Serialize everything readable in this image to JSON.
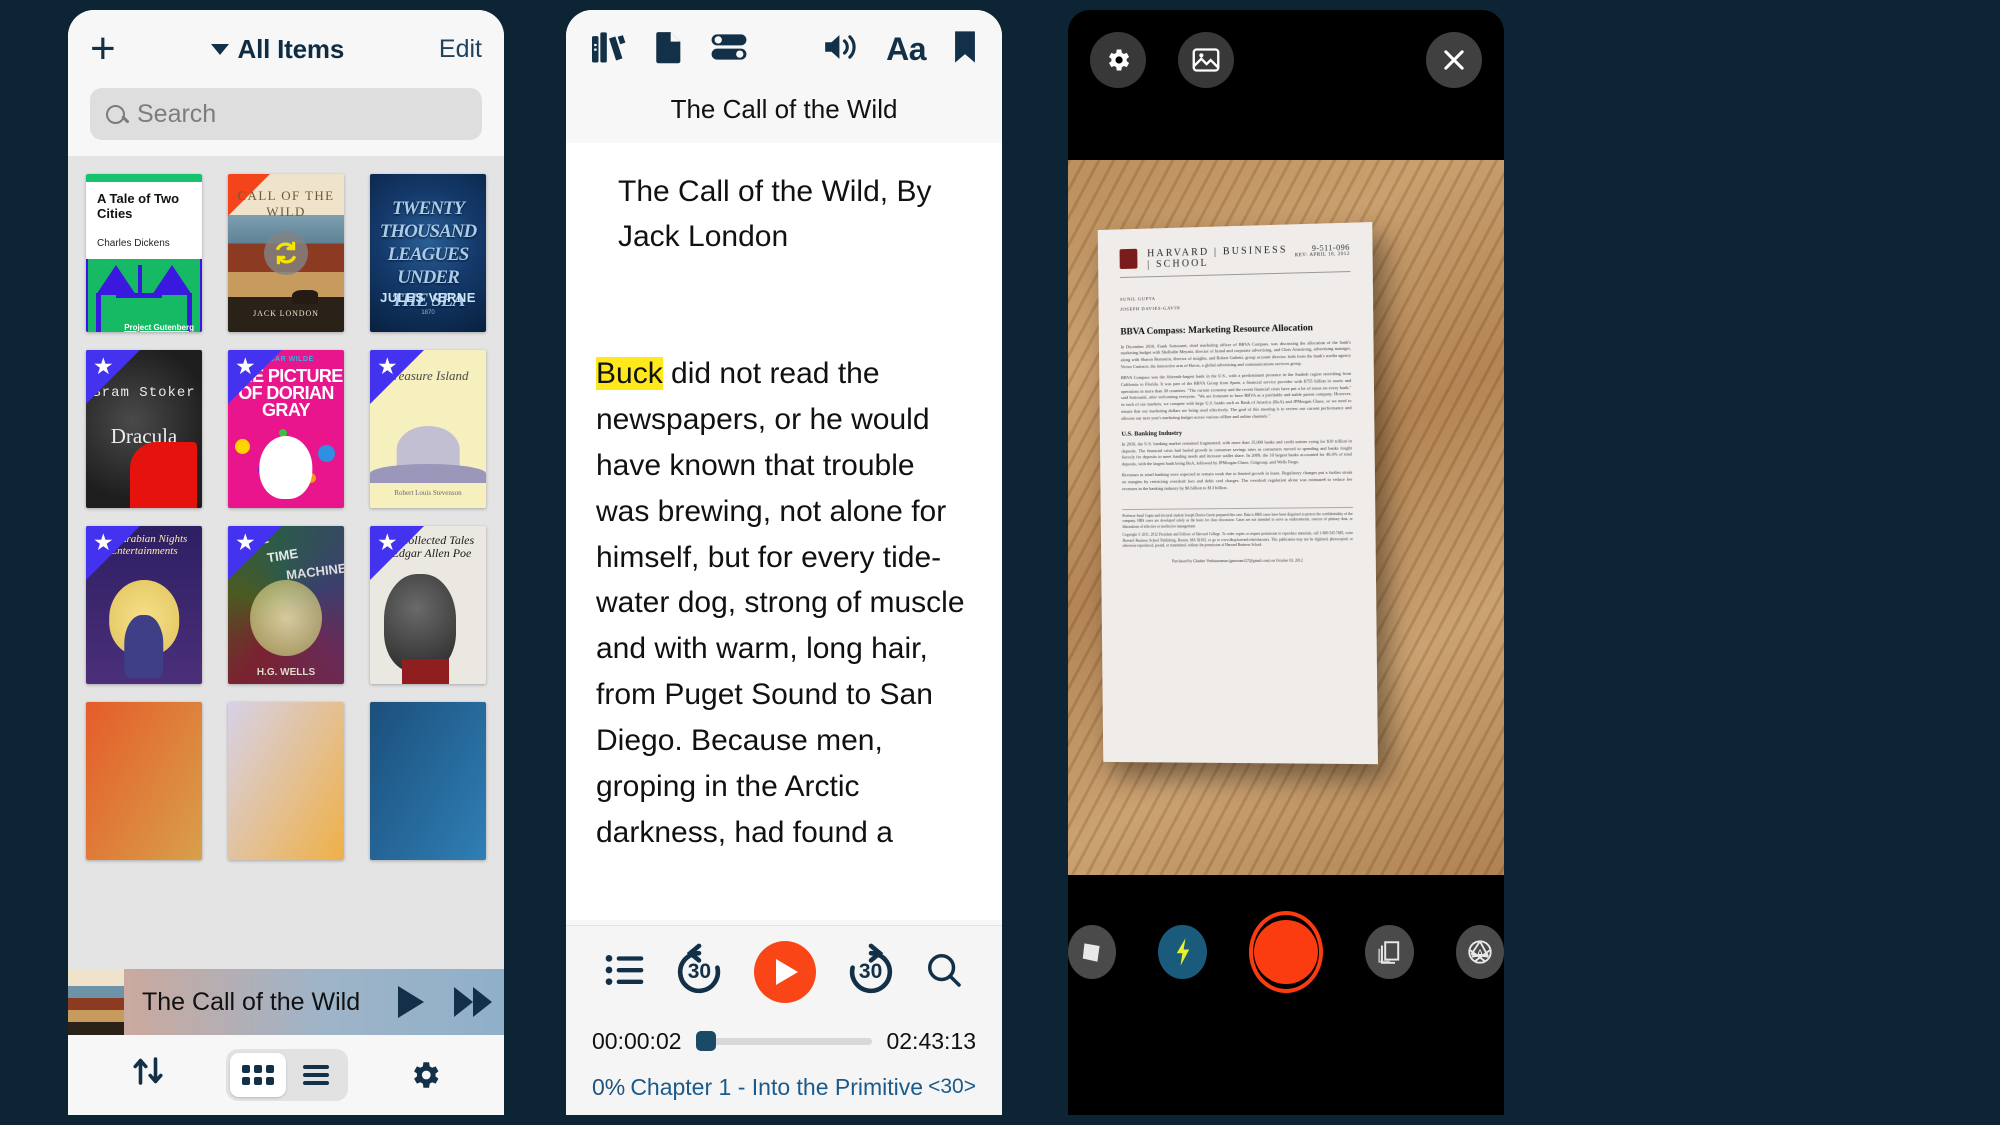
{
  "library": {
    "add_label": "+",
    "title": "All Items",
    "edit_label": "Edit",
    "search_placeholder": "Search",
    "books": [
      {
        "title": "A Tale of Two Cities",
        "author": "Charles Dickens",
        "publisher": "Project Gutenberg",
        "starred": false,
        "syncing": false
      },
      {
        "title": "CALL OF THE WILD",
        "author": "JACK LONDON",
        "starred": false,
        "syncing": true
      },
      {
        "title": "TWENTY THOUSAND LEAGUES UNDER THE SEA",
        "author": "JULES VERNE",
        "starred": false,
        "syncing": false
      },
      {
        "title": "Dracula",
        "author": "Bram Stoker",
        "starred": true,
        "syncing": false
      },
      {
        "title": "THE PICTURE OF DORIAN GRAY",
        "author": "OSCAR WILDE",
        "starred": true,
        "syncing": false
      },
      {
        "title": "Treasure Island",
        "author": "Robert Louis Stevenson",
        "starred": true,
        "syncing": false
      },
      {
        "title": "The Arabian Nights Entertainments",
        "author": "",
        "starred": true,
        "syncing": false
      },
      {
        "title": "THE TIME MACHINE",
        "author": "H.G. WELLS",
        "starred": true,
        "syncing": false
      },
      {
        "title": "The Collected Tales of Edgar Allen Poe",
        "author": "",
        "starred": true,
        "syncing": false
      }
    ],
    "mini_player": {
      "title": "The Call of the Wild",
      "play_icon": "play-icon",
      "forward_icon": "fast-forward-icon"
    },
    "tabbar": {
      "sort_icon": "sort-arrows-icon",
      "grid_icon": "grid-view-icon",
      "list_icon": "list-view-icon",
      "settings_icon": "gear-icon",
      "active_view": "grid"
    }
  },
  "reader": {
    "toolbar_left": [
      {
        "icon": "bookshelf-icon",
        "label": "Library"
      },
      {
        "icon": "document-icon",
        "label": "Document"
      },
      {
        "icon": "sliders-icon",
        "label": "Settings"
      }
    ],
    "toolbar_right": [
      {
        "icon": "speaker-icon",
        "label": "Audio"
      },
      {
        "icon": "text-size-icon",
        "label": "Aa"
      },
      {
        "icon": "bookmark-icon",
        "label": "Bookmark"
      }
    ],
    "title": "The Call of the Wild",
    "heading": "The Call of the Wild, By Jack London",
    "highlight_word": "Buck",
    "paragraph": " did not read the newspapers, or he would have known that trouble was brewing, not alone for himself, but for every tide- water dog, strong of muscle and with warm, long hair, from Puget Sound to San Diego. Because men, groping in the Arctic darkness, had found a",
    "controls": {
      "toc_icon": "list-icon",
      "rewind_label": "30",
      "play_icon": "play-icon",
      "forward_label": "30",
      "search_icon": "search-icon"
    },
    "elapsed": "00:00:02",
    "duration": "02:43:13",
    "progress_percent": "0%",
    "chapter": "Chapter 1 - Into the Primitive",
    "chapter_nav": "30",
    "progress_value": 0
  },
  "scanner": {
    "settings_icon": "gear-icon",
    "gallery_icon": "image-icon",
    "close_icon": "close-icon",
    "document": {
      "institution": "HARVARD | BUSINESS | SCHOOL",
      "code": "9-511-096",
      "revision": "REV: APRIL 18, 2012",
      "author_1": "SUNIL GUPTA",
      "author_2": "JOSEPH DAVIES-GAVIN",
      "title": "BBVA Compass: Marketing Resource Allocation",
      "para_1": "In December 2010, Frank Sottosanti, chief marketing officer of BBVA Compass, was discussing the allocation of the bank's marketing budget with Shelludin Meyatti, director of brand and corporate advertising, and Chris Armstrong, advertising manager, along with Sharon Bernstein, director of insights, and Robert Galietti, group account director, both from the bank's media agency Vector Contacts, the interactive arm of Havas, a global advertising and communications services group.",
      "para_2": "BBVA Compass was the fifteenth-largest bank in the U.S., with a predominant presence in the Sunbelt region stretching from California to Florida. It was part of the BBVA Group from Spain, a financial service provider with $755 billion in assets and operations in more than 30 countries. \"The current economy and the recent financial crisis have put a lot of stress on every bank,\" said Sottosanti, after welcoming everyone. \"We are fortunate to have BBVA as a profitable and stable parent company. However, in each of our markets, we compete with large U.S. banks such as Bank of America (BoA) and JPMorgan Chase, so we need to ensure that our marketing dollars are being used effectively. The goal of this meeting is to review our current performance and allocate our next year's marketing budget across various offline and online channels.\"",
      "h2": "U.S. Banking Industry",
      "para_3": "In 2010, the U.S. banking market remained fragmented, with more than 15,000 banks and credit unions vying for $10 trillion in deposits. The financial crisis had fueled growth in consumer savings rates as consumers moved to spending and banks fought fiercely for deposits to meet funding needs and increase wallet share. In 2009, the 10 largest banks accounted for 46.4% of total deposits, with the largest bank being BoA, followed by JPMorgan Chase, Citigroup, and Wells Fargo.",
      "para_4": "Revenues in retail banking were expected to remain weak due to limited growth in loans. Regulatory changes put a further strain on margins by restricting overdraft fees and debit card charges. The overdraft regulation alone was estimated to reduce fee revenues in the banking industry by $6 billion to $13 billion.",
      "footnote": "Professor Sunil Gupta and doctoral student Joseph Davies-Gavin prepared this case. Data is HBS cases have been disguised to protect the confidentiality of the company. HBS cases are developed solely as the basis for class discussion. Cases are not intended to serve as endorsements, sources of primary data, or illustrations of effective or ineffective management.",
      "copyright": "Copyright © 2011, 2012 President and Fellows of Harvard College. To order copies or request permission to reproduce materials, call 1-800-545-7685, write Harvard Business School Publishing, Boston, MA 02163, or go to www.hbsp.harvard.edu/educators. This publication may not be digitized, photocopied, or otherwise reproduced, posted, or transmitted, without the permission of Harvard Business School.",
      "purchased": "Purchased by Glauber Venkataraman (gauriram127@gmail.com) on October 03, 2012"
    },
    "controls": [
      {
        "icon": "crop-perspective-icon",
        "label": "Crop"
      },
      {
        "icon": "flash-icon",
        "label": "Flash"
      },
      {
        "icon": "shutter-icon",
        "label": "Capture"
      },
      {
        "icon": "multi-page-icon",
        "label": "Batch"
      },
      {
        "icon": "auto-aperture-icon",
        "label": "Auto"
      }
    ]
  },
  "colors": {
    "background": "#0c2433",
    "accent_navy": "#123047",
    "accent_orange": "#fa4616",
    "highlight_yellow": "#ffe81c",
    "link_blue": "#1b5a8a"
  }
}
